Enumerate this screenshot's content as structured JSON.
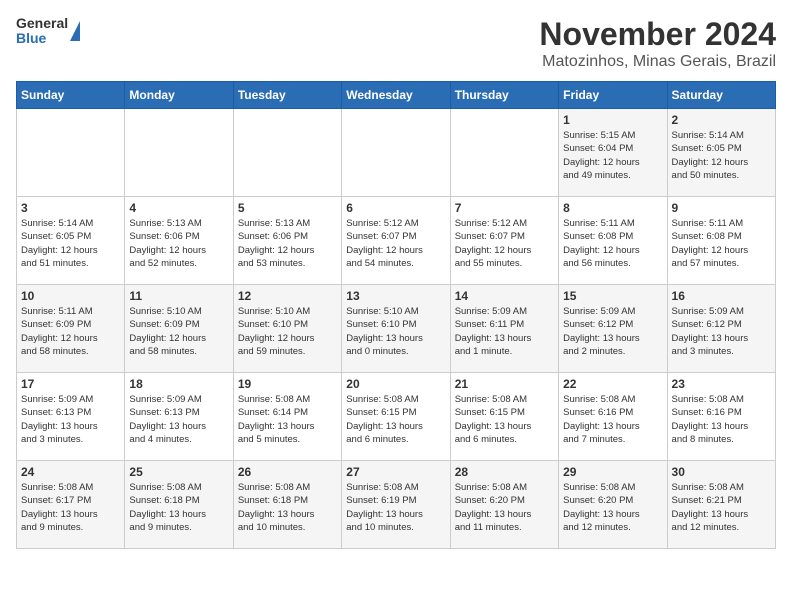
{
  "header": {
    "logo_general": "General",
    "logo_blue": "Blue",
    "title": "November 2024",
    "subtitle": "Matozinhos, Minas Gerais, Brazil"
  },
  "days_of_week": [
    "Sunday",
    "Monday",
    "Tuesday",
    "Wednesday",
    "Thursday",
    "Friday",
    "Saturday"
  ],
  "weeks": [
    [
      {
        "day": "",
        "info": ""
      },
      {
        "day": "",
        "info": ""
      },
      {
        "day": "",
        "info": ""
      },
      {
        "day": "",
        "info": ""
      },
      {
        "day": "",
        "info": ""
      },
      {
        "day": "1",
        "info": "Sunrise: 5:15 AM\nSunset: 6:04 PM\nDaylight: 12 hours\nand 49 minutes."
      },
      {
        "day": "2",
        "info": "Sunrise: 5:14 AM\nSunset: 6:05 PM\nDaylight: 12 hours\nand 50 minutes."
      }
    ],
    [
      {
        "day": "3",
        "info": "Sunrise: 5:14 AM\nSunset: 6:05 PM\nDaylight: 12 hours\nand 51 minutes."
      },
      {
        "day": "4",
        "info": "Sunrise: 5:13 AM\nSunset: 6:06 PM\nDaylight: 12 hours\nand 52 minutes."
      },
      {
        "day": "5",
        "info": "Sunrise: 5:13 AM\nSunset: 6:06 PM\nDaylight: 12 hours\nand 53 minutes."
      },
      {
        "day": "6",
        "info": "Sunrise: 5:12 AM\nSunset: 6:07 PM\nDaylight: 12 hours\nand 54 minutes."
      },
      {
        "day": "7",
        "info": "Sunrise: 5:12 AM\nSunset: 6:07 PM\nDaylight: 12 hours\nand 55 minutes."
      },
      {
        "day": "8",
        "info": "Sunrise: 5:11 AM\nSunset: 6:08 PM\nDaylight: 12 hours\nand 56 minutes."
      },
      {
        "day": "9",
        "info": "Sunrise: 5:11 AM\nSunset: 6:08 PM\nDaylight: 12 hours\nand 57 minutes."
      }
    ],
    [
      {
        "day": "10",
        "info": "Sunrise: 5:11 AM\nSunset: 6:09 PM\nDaylight: 12 hours\nand 58 minutes."
      },
      {
        "day": "11",
        "info": "Sunrise: 5:10 AM\nSunset: 6:09 PM\nDaylight: 12 hours\nand 58 minutes."
      },
      {
        "day": "12",
        "info": "Sunrise: 5:10 AM\nSunset: 6:10 PM\nDaylight: 12 hours\nand 59 minutes."
      },
      {
        "day": "13",
        "info": "Sunrise: 5:10 AM\nSunset: 6:10 PM\nDaylight: 13 hours\nand 0 minutes."
      },
      {
        "day": "14",
        "info": "Sunrise: 5:09 AM\nSunset: 6:11 PM\nDaylight: 13 hours\nand 1 minute."
      },
      {
        "day": "15",
        "info": "Sunrise: 5:09 AM\nSunset: 6:12 PM\nDaylight: 13 hours\nand 2 minutes."
      },
      {
        "day": "16",
        "info": "Sunrise: 5:09 AM\nSunset: 6:12 PM\nDaylight: 13 hours\nand 3 minutes."
      }
    ],
    [
      {
        "day": "17",
        "info": "Sunrise: 5:09 AM\nSunset: 6:13 PM\nDaylight: 13 hours\nand 3 minutes."
      },
      {
        "day": "18",
        "info": "Sunrise: 5:09 AM\nSunset: 6:13 PM\nDaylight: 13 hours\nand 4 minutes."
      },
      {
        "day": "19",
        "info": "Sunrise: 5:08 AM\nSunset: 6:14 PM\nDaylight: 13 hours\nand 5 minutes."
      },
      {
        "day": "20",
        "info": "Sunrise: 5:08 AM\nSunset: 6:15 PM\nDaylight: 13 hours\nand 6 minutes."
      },
      {
        "day": "21",
        "info": "Sunrise: 5:08 AM\nSunset: 6:15 PM\nDaylight: 13 hours\nand 6 minutes."
      },
      {
        "day": "22",
        "info": "Sunrise: 5:08 AM\nSunset: 6:16 PM\nDaylight: 13 hours\nand 7 minutes."
      },
      {
        "day": "23",
        "info": "Sunrise: 5:08 AM\nSunset: 6:16 PM\nDaylight: 13 hours\nand 8 minutes."
      }
    ],
    [
      {
        "day": "24",
        "info": "Sunrise: 5:08 AM\nSunset: 6:17 PM\nDaylight: 13 hours\nand 9 minutes."
      },
      {
        "day": "25",
        "info": "Sunrise: 5:08 AM\nSunset: 6:18 PM\nDaylight: 13 hours\nand 9 minutes."
      },
      {
        "day": "26",
        "info": "Sunrise: 5:08 AM\nSunset: 6:18 PM\nDaylight: 13 hours\nand 10 minutes."
      },
      {
        "day": "27",
        "info": "Sunrise: 5:08 AM\nSunset: 6:19 PM\nDaylight: 13 hours\nand 10 minutes."
      },
      {
        "day": "28",
        "info": "Sunrise: 5:08 AM\nSunset: 6:20 PM\nDaylight: 13 hours\nand 11 minutes."
      },
      {
        "day": "29",
        "info": "Sunrise: 5:08 AM\nSunset: 6:20 PM\nDaylight: 13 hours\nand 12 minutes."
      },
      {
        "day": "30",
        "info": "Sunrise: 5:08 AM\nSunset: 6:21 PM\nDaylight: 13 hours\nand 12 minutes."
      }
    ]
  ]
}
